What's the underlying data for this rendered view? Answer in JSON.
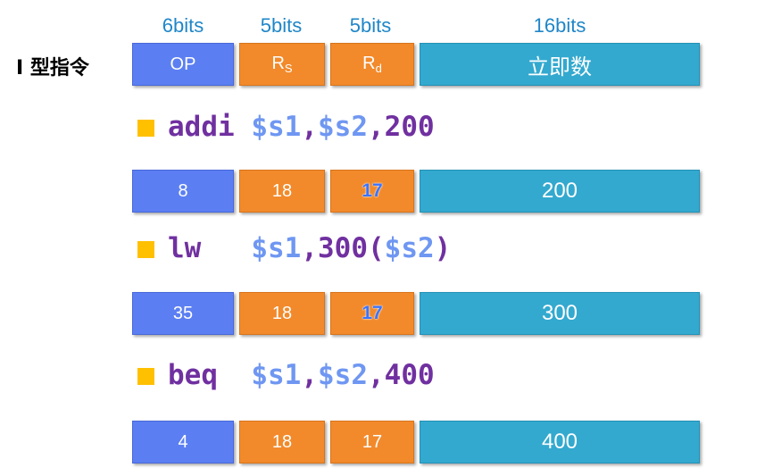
{
  "header": {
    "bits": [
      "6bits",
      "5bits",
      "5bits",
      "16bits"
    ],
    "type_label": "I 型指令",
    "fields": {
      "op": "OP",
      "rs_main": "R",
      "rs_sub": "S",
      "rd_main": "R",
      "rd_sub": "d",
      "imm": "立即数"
    }
  },
  "instructions": [
    {
      "mnemonic": "addi",
      "reg1": "$s1",
      "sep1": ",",
      "reg2": "$s2",
      "sep2": ",",
      "imm": "200",
      "tail": "",
      "encoding": [
        "8",
        "18",
        "17",
        "200"
      ]
    },
    {
      "mnemonic": "lw",
      "reg1": "$s1",
      "sep1": ",",
      "reg2": "300(",
      "sep2": "",
      "imm": "$s2",
      "tail": ")",
      "encoding": [
        "35",
        "18",
        "17",
        "300"
      ]
    },
    {
      "mnemonic": "beq",
      "reg1": "$s1",
      "sep1": ",",
      "reg2": "$s2",
      "sep2": ",",
      "imm": "400",
      "tail": "",
      "encoding": [
        "4",
        "18",
        "17",
        "400"
      ]
    }
  ],
  "colors": {
    "op": "#5b7ff2",
    "reg": "#f28a2b",
    "imm": "#33a9cf",
    "bullet": "#ffc000",
    "mnemonic": "#7030a0",
    "register": "#6f97f2",
    "bits": "#1f86c8"
  }
}
